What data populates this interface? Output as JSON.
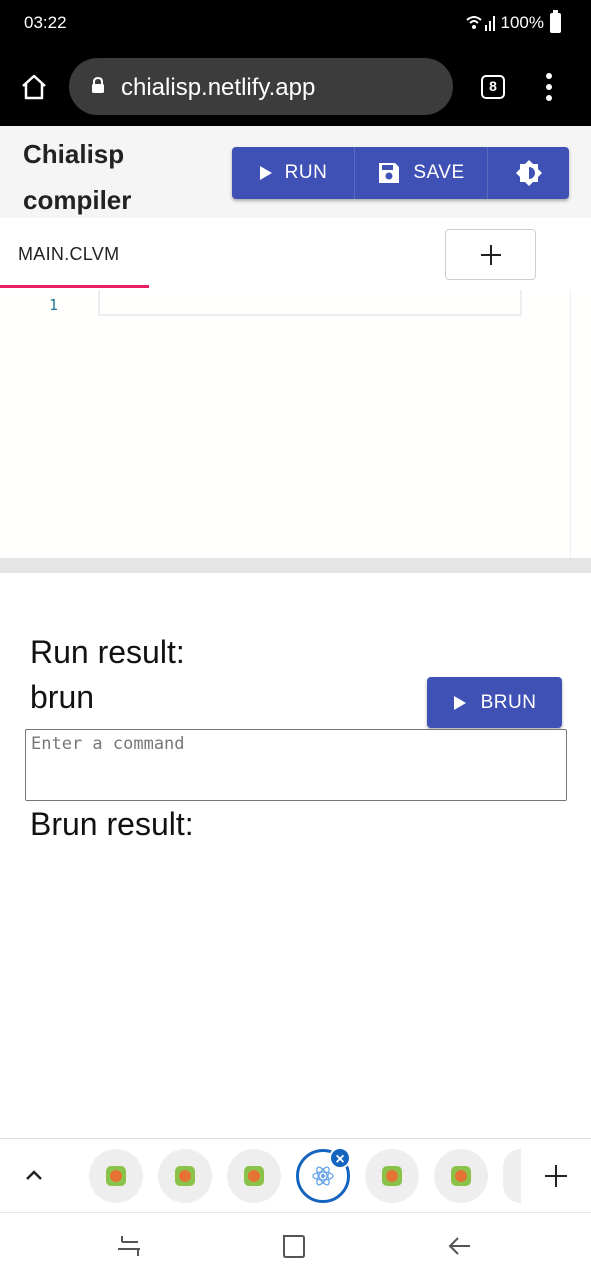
{
  "status_bar": {
    "time": "03:22",
    "battery": "100%"
  },
  "browser": {
    "url": "chialisp.netlify.app",
    "tab_count": "8"
  },
  "app": {
    "title": "Chialisp compiler",
    "toolbar": {
      "run_label": "RUN",
      "save_label": "SAVE"
    }
  },
  "editor": {
    "tabs": [
      {
        "label": "MAIN.CLVM"
      }
    ],
    "line_numbers": [
      "1"
    ]
  },
  "results": {
    "run_result_label": "Run result:",
    "brun_label": "brun",
    "brun_button_label": "BRUN",
    "command_placeholder": "Enter a command",
    "brun_result_label": "Brun result:"
  },
  "colors": {
    "primary": "#3f51b5",
    "tab_indicator": "#e91e63",
    "active_tab_ring": "#1565c0"
  },
  "bottom_tabs": {
    "icons": [
      "app-favicon-icon",
      "app-favicon-icon",
      "app-favicon-icon",
      "react-icon",
      "app-favicon-icon",
      "app-favicon-icon"
    ]
  }
}
